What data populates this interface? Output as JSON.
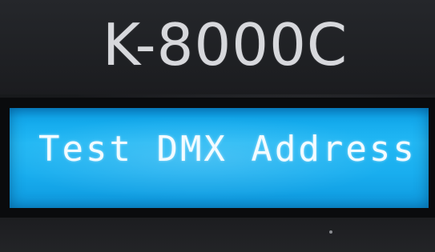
{
  "device": {
    "model": "K-8000C",
    "lcd_text": "Test DMX Address"
  },
  "colors": {
    "panel": "#1b1c1f",
    "lcd_background": "#1fb4f2",
    "lcd_text": "#f3fbff",
    "model_label": "#d7d8dc"
  }
}
